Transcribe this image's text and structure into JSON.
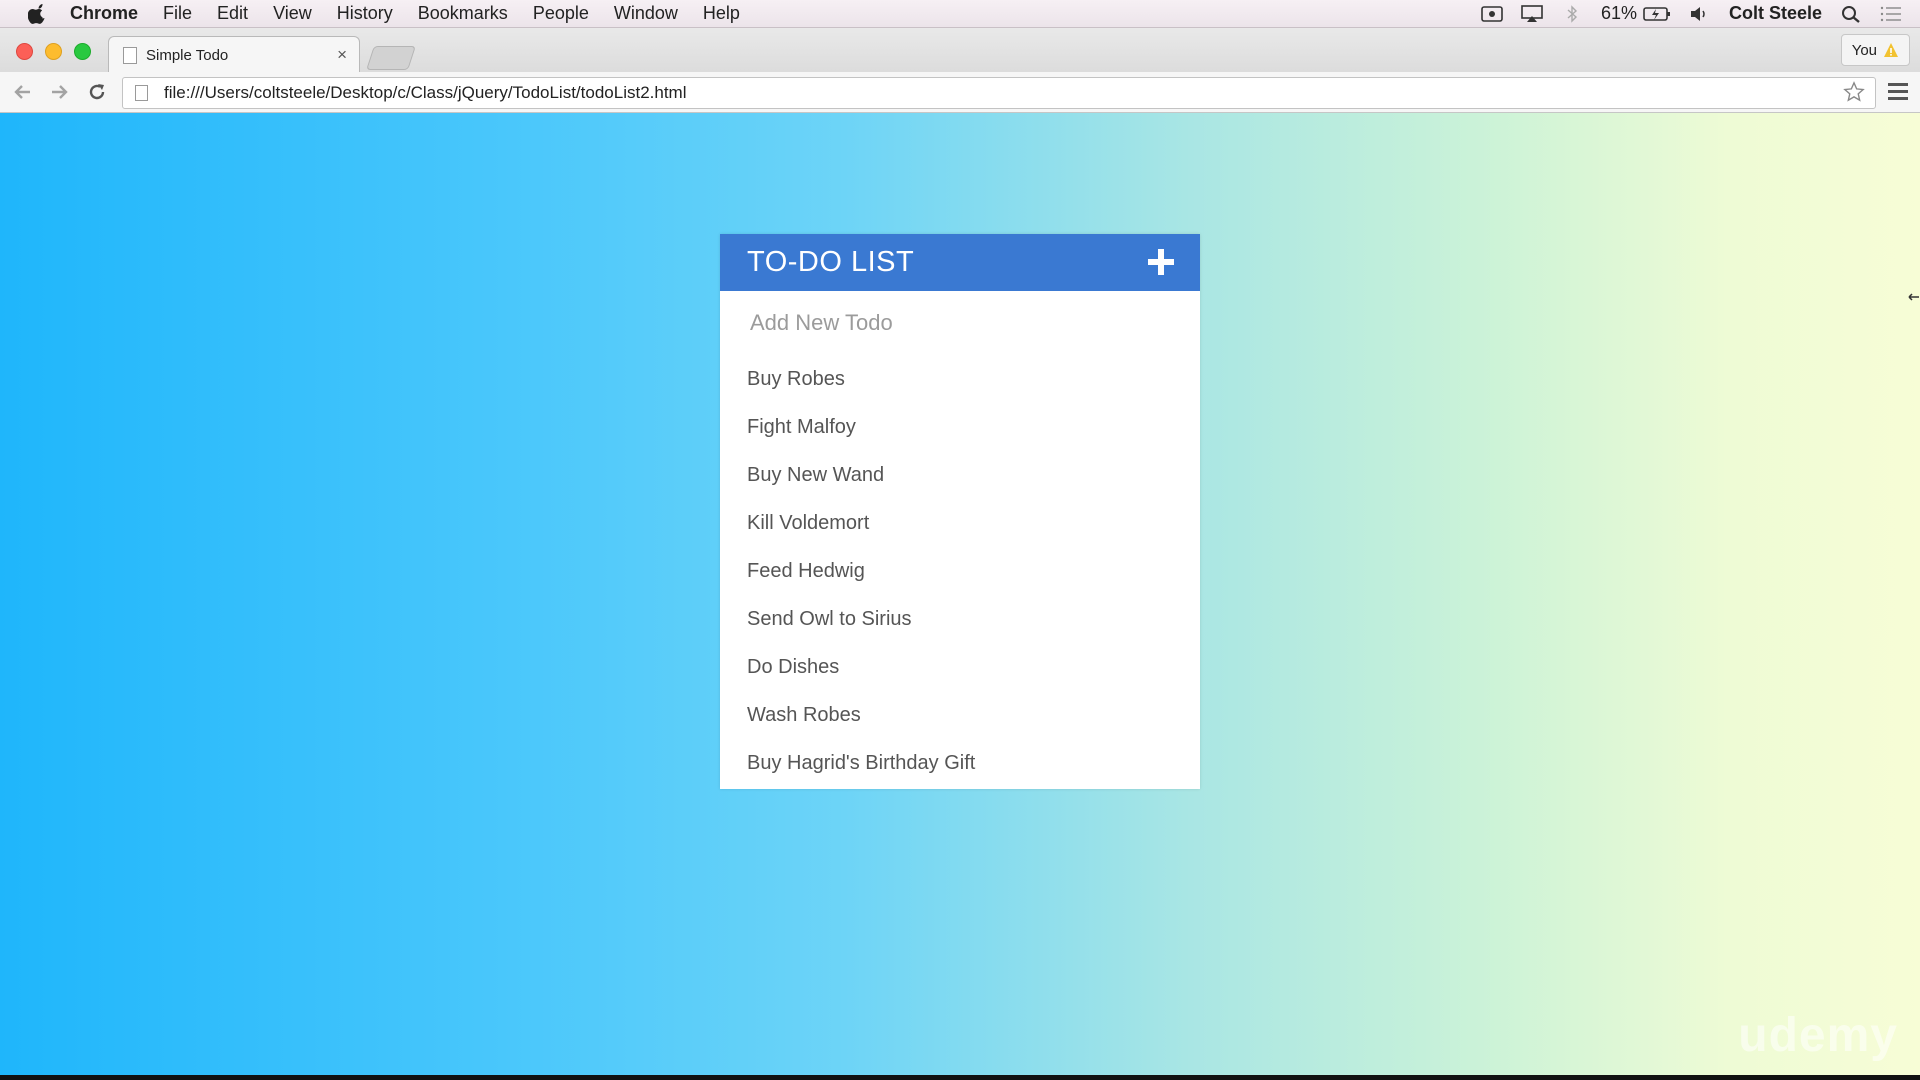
{
  "menubar": {
    "app": "Chrome",
    "items": [
      "File",
      "Edit",
      "View",
      "History",
      "Bookmarks",
      "People",
      "Window",
      "Help"
    ],
    "battery": "61%",
    "user": "Colt Steele"
  },
  "tab": {
    "title": "Simple Todo",
    "close": "×"
  },
  "profile": {
    "label": "You"
  },
  "address": {
    "url": "file:///Users/coltsteele/Desktop/c/Class/jQuery/TodoList/todoList2.html"
  },
  "todo": {
    "title": "TO-DO LIST",
    "input_placeholder": "Add New Todo",
    "items": [
      "Buy Robes",
      "Fight Malfoy",
      "Buy New Wand",
      "Kill Voldemort",
      "Feed Hedwig",
      "Send Owl to Sirius",
      "Do Dishes",
      "Wash Robes",
      "Buy Hagrid's Birthday Gift"
    ]
  },
  "watermark": "udemy",
  "colors": {
    "header": "#3a79d2",
    "bg_left": "#1fb6fb",
    "bg_right": "#f7fdd6"
  }
}
